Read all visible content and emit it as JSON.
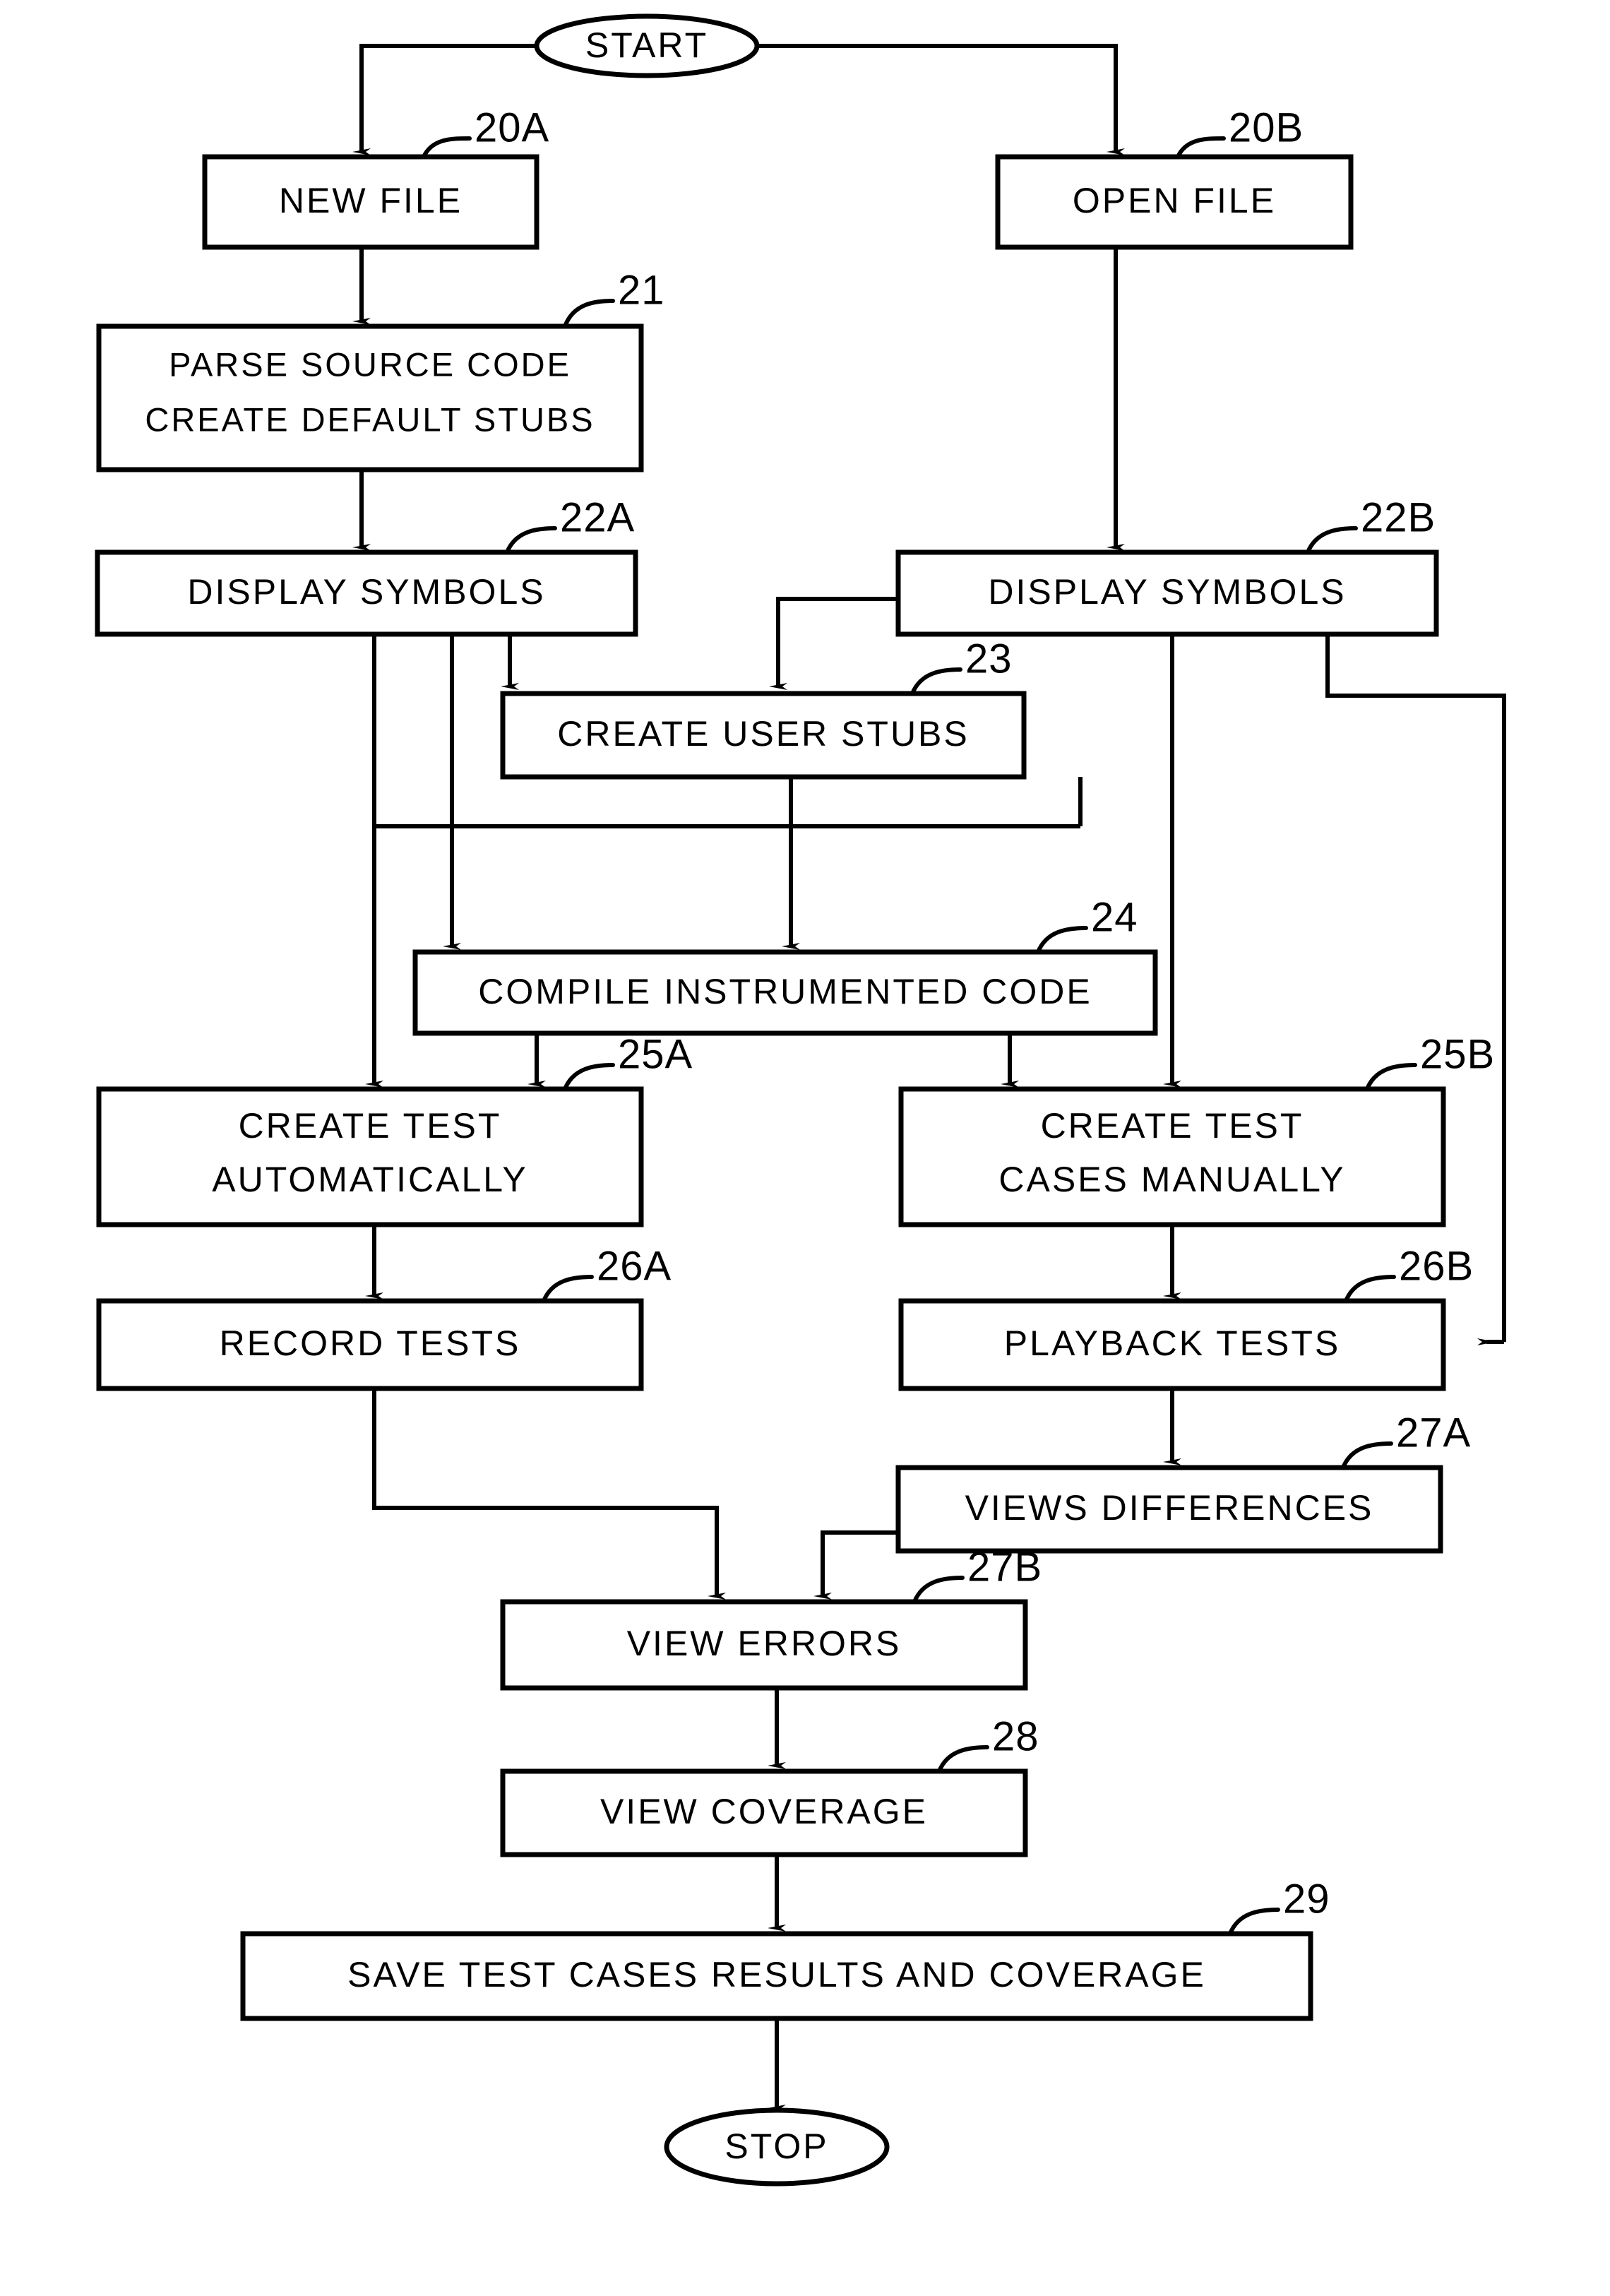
{
  "diagram": {
    "type": "flowchart",
    "title": "",
    "terminators": [
      {
        "id": "start",
        "label": "START"
      },
      {
        "id": "stop",
        "label": "STOP"
      }
    ],
    "nodes": [
      {
        "ref": "20A",
        "label": "NEW FILE",
        "lines": [
          "NEW  FILE"
        ]
      },
      {
        "ref": "20B",
        "label": "OPEN FILE",
        "lines": [
          "OPEN  FILE"
        ]
      },
      {
        "ref": "21",
        "label": "PARSE SOURCE CODE CREATE DEFAULT STUBS",
        "lines": [
          "PARSE  SOURCE  CODE",
          "CREATE DEFAULT STUBS"
        ]
      },
      {
        "ref": "22A",
        "label": "DISPLAY SYMBOLS",
        "lines": [
          "DISPLAY  SYMBOLS"
        ]
      },
      {
        "ref": "22B",
        "label": "DISPLAY SYMBOLS",
        "lines": [
          "DISPLAY  SYMBOLS"
        ]
      },
      {
        "ref": "23",
        "label": "CREATE USER STUBS",
        "lines": [
          "CREATE  USER  STUBS"
        ]
      },
      {
        "ref": "24",
        "label": "COMPILE INSTRUMENTED CODE",
        "lines": [
          "COMPILE  INSTRUMENTED  CODE"
        ]
      },
      {
        "ref": "25A",
        "label": "CREATE TEST AUTOMATICALLY",
        "lines": [
          "CREATE  TEST",
          "AUTOMATICALLY"
        ]
      },
      {
        "ref": "25B",
        "label": "CREATE TEST CASES MANUALLY",
        "lines": [
          "CREATE  TEST",
          "CASES  MANUALLY"
        ]
      },
      {
        "ref": "26A",
        "label": "RECORD TESTS",
        "lines": [
          "RECORD  TESTS"
        ]
      },
      {
        "ref": "26B",
        "label": "PLAYBACK TESTS",
        "lines": [
          "PLAYBACK  TESTS"
        ]
      },
      {
        "ref": "27A",
        "label": "VIEWS DIFFERENCES",
        "lines": [
          "VIEWS  DIFFERENCES"
        ]
      },
      {
        "ref": "27B",
        "label": "VIEW ERRORS",
        "lines": [
          "VIEW  ERRORS"
        ]
      },
      {
        "ref": "28",
        "label": "VIEW COVERAGE",
        "lines": [
          "VIEW  COVERAGE"
        ]
      },
      {
        "ref": "29",
        "label": "SAVE TEST CASES RESULTS AND COVERAGE",
        "lines": [
          "SAVE TEST CASES RESULTS AND COVERAGE"
        ]
      }
    ],
    "edges": [
      {
        "from": "start",
        "to": "20A"
      },
      {
        "from": "start",
        "to": "20B"
      },
      {
        "from": "20A",
        "to": "21"
      },
      {
        "from": "21",
        "to": "22A"
      },
      {
        "from": "20B",
        "to": "22B"
      },
      {
        "from": "22A",
        "to": "23"
      },
      {
        "from": "22B",
        "to": "23"
      },
      {
        "from": "22A",
        "to": "24"
      },
      {
        "from": "23",
        "to": "24"
      },
      {
        "from": "23",
        "to": "25B"
      },
      {
        "from": "22A",
        "to": "25A"
      },
      {
        "from": "24",
        "to": "25A"
      },
      {
        "from": "24",
        "to": "25B"
      },
      {
        "from": "22B",
        "to": "25B"
      },
      {
        "from": "22B",
        "to": "26B"
      },
      {
        "from": "25A",
        "to": "26A"
      },
      {
        "from": "25B",
        "to": "26B"
      },
      {
        "from": "26B",
        "to": "27A"
      },
      {
        "from": "26A",
        "to": "27B"
      },
      {
        "from": "27A",
        "to": "27B"
      },
      {
        "from": "27B",
        "to": "28"
      },
      {
        "from": "28",
        "to": "29"
      },
      {
        "from": "29",
        "to": "stop"
      }
    ],
    "colors": {
      "stroke": "#000000",
      "fill": "#ffffff",
      "background": "#ffffff"
    }
  }
}
